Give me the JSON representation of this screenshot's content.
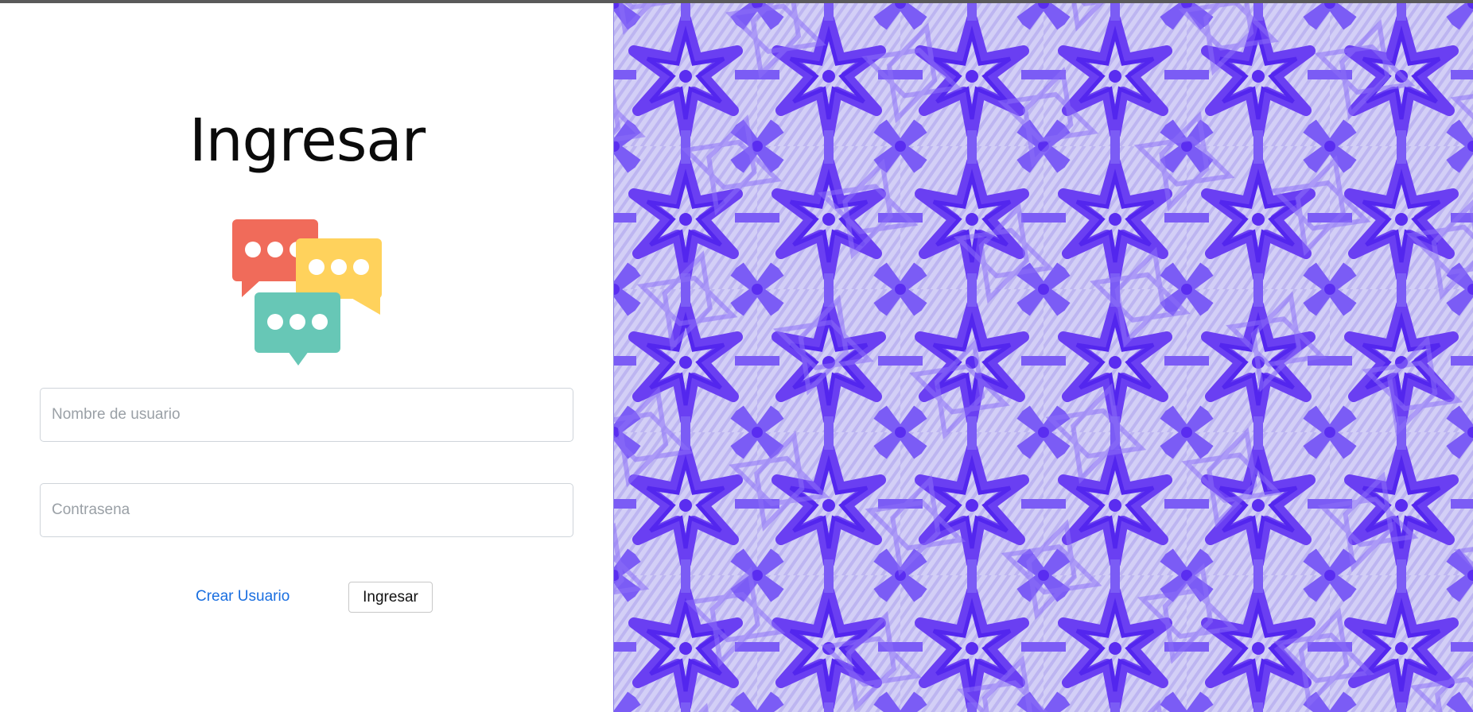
{
  "login": {
    "title": "Ingresar",
    "username_placeholder": "Nombre de usuario",
    "password_placeholder": "Contrasena",
    "create_user_link": "Crear Usuario",
    "submit_button": "Ingresar"
  },
  "logo": {
    "icon": "chat-bubbles-icon",
    "colors": {
      "red": "#f06b5a",
      "yellow": "#ffd25c",
      "teal": "#67c7b6"
    }
  },
  "background": {
    "pattern": "purple-geometric-tile",
    "colors": {
      "dark": "#5a2df0",
      "mid": "#7b5cf5",
      "light": "#d3cff6",
      "stripe": "#a9a1ec"
    }
  }
}
